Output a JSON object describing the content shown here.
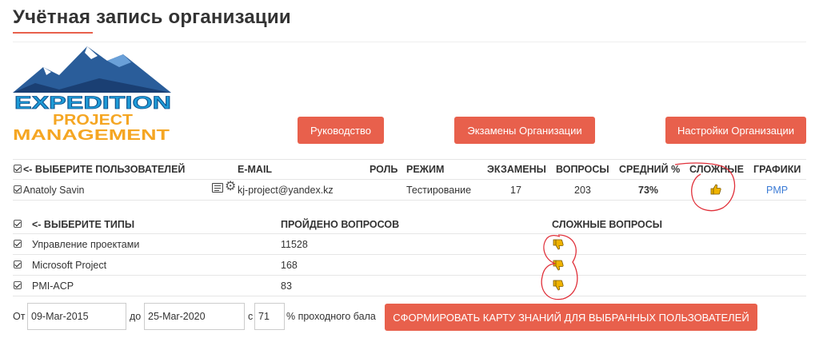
{
  "page": {
    "title": "Учётная запись организации"
  },
  "logo": {
    "line1": "EXPEDITION",
    "line2": "PROJECT",
    "line3": "MANAGEMENT"
  },
  "buttons": {
    "guide": "Руководство",
    "exams": "Экзамены Организации",
    "settings": "Настройки Организации"
  },
  "users_table": {
    "headers": {
      "select": "<- ВЫБЕРИТЕ ПОЛЬЗОВАТЕЛЕЙ",
      "email": "E-MAIL",
      "role": "РОЛЬ",
      "mode": "РЕЖИМ",
      "exams": "ЭКЗАМЕНЫ",
      "questions": "ВОПРОСЫ",
      "average": "СРЕДНИЙ %",
      "hard": "СЛОЖНЫЕ",
      "charts": "ГРАФИКИ"
    },
    "rows": [
      {
        "name": "Anatoly Savin",
        "email": "kj-project@yandex.kz",
        "role": "",
        "mode": "Тестирование",
        "exams": "17",
        "questions": "203",
        "average": "73%",
        "hard_icon": "thumbs-up-icon",
        "charts": "PMP"
      }
    ]
  },
  "types_table": {
    "headers": {
      "select": "<- ВЫБЕРИТЕ ТИПЫ",
      "passed": "ПРОЙДЕНО ВОПРОСОВ",
      "hard": "СЛОЖНЫЕ ВОПРОСЫ"
    },
    "rows": [
      {
        "type": "Управление проектами",
        "passed": "11528",
        "hard_icon": "thumbs-down-icon"
      },
      {
        "type": "Microsoft Project",
        "passed": "168",
        "hard_icon": "thumbs-down-icon"
      },
      {
        "type": "PMI-ACP",
        "passed": "83",
        "hard_icon": "thumbs-down-icon"
      }
    ]
  },
  "filter": {
    "from_label": "От",
    "from_value": "09-Mar-2015",
    "to_label": "до",
    "to_value": "25-Mar-2020",
    "with_label": "с",
    "percent_value": "71",
    "percent_label": "% проходного бала",
    "submit": "СФОРМИРОВАТЬ КАРТУ ЗНАНИЙ ДЛЯ ВЫБРАННЫХ ПОЛЬЗОВАТЕЛЕЙ"
  },
  "colors": {
    "accent": "#e8604c",
    "link": "#3b7bd6",
    "thumb": "#f0b400",
    "annotation": "#e0303a"
  }
}
